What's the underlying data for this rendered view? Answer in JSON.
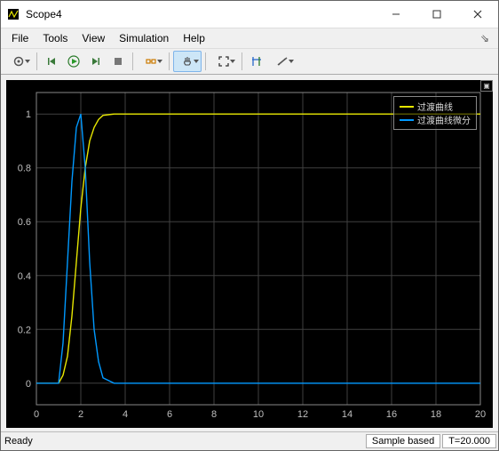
{
  "window": {
    "title": "Scope4"
  },
  "menu": {
    "file": "File",
    "tools": "Tools",
    "view": "View",
    "simulation": "Simulation",
    "help": "Help"
  },
  "status": {
    "ready": "Ready",
    "mode": "Sample based",
    "time": "T=20.000"
  },
  "legend": {
    "series1": {
      "label": "过渡曲线",
      "color": "#e6e600"
    },
    "series2": {
      "label": "过渡曲线微分",
      "color": "#0099ff"
    }
  },
  "chart_data": {
    "type": "line",
    "xlim": [
      0,
      20
    ],
    "ylim": [
      -0.08,
      1.08
    ],
    "xticks": [
      0,
      2,
      4,
      6,
      8,
      10,
      12,
      14,
      16,
      18,
      20
    ],
    "yticks": [
      0,
      0.2,
      0.4,
      0.6,
      0.8,
      1
    ],
    "series": [
      {
        "name": "过渡曲线",
        "color": "#e6e600",
        "x": [
          0,
          1,
          1.2,
          1.4,
          1.6,
          1.8,
          2.0,
          2.2,
          2.4,
          2.6,
          2.8,
          3.0,
          3.5,
          4,
          6,
          10,
          20
        ],
        "y": [
          0,
          0,
          0.03,
          0.1,
          0.25,
          0.45,
          0.65,
          0.8,
          0.9,
          0.95,
          0.98,
          0.995,
          1,
          1,
          1,
          1,
          1
        ]
      },
      {
        "name": "过渡曲线微分",
        "color": "#0099ff",
        "x": [
          0,
          1,
          1.2,
          1.4,
          1.6,
          1.8,
          2.0,
          2.2,
          2.4,
          2.6,
          2.8,
          3.0,
          3.5,
          4,
          20
        ],
        "y": [
          0,
          0,
          0.15,
          0.45,
          0.75,
          0.95,
          1.0,
          0.8,
          0.45,
          0.2,
          0.08,
          0.02,
          0,
          0,
          0
        ]
      }
    ]
  },
  "colors": {
    "bg": "#000000",
    "grid": "#404040",
    "axis": "#888888",
    "tick": "#bfbfbf"
  }
}
